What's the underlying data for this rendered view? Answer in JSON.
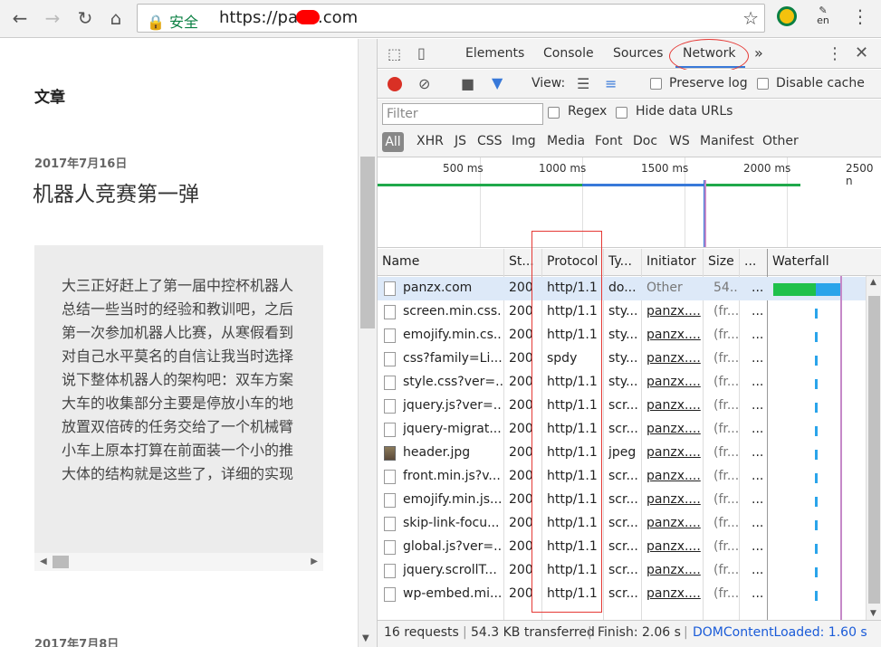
{
  "browser": {
    "secure_label": "安全",
    "url_prefix": "https://pa",
    "url_suffix": ".com",
    "ext_label": "en"
  },
  "page": {
    "section_title": "文章",
    "post_date": "2017年7月16日",
    "post_title": "机器人竞赛第一弹",
    "excerpt": [
      "大三正好赶上了第一届中控杯机器人",
      "总结一些当时的经验和教训吧，之后",
      "第一次参加机器人比赛，从寒假看到",
      "对自己水平莫名的自信让我当时选择",
      "说下整体机器人的架构吧：双车方案",
      "大车的收集部分主要是停放小车的地",
      "放置双倍砖的任务交给了一个机械臂",
      "小车上原本打算在前面装一个小的推",
      "大体的结构就是这些了，详细的实现"
    ],
    "next_post_date": "2017年7月8日"
  },
  "devtools": {
    "tabs": [
      "Elements",
      "Console",
      "Sources",
      "Network"
    ],
    "active_tab": "Network",
    "more_tabs": "»",
    "view_label": "View:",
    "preserve_log": "Preserve log",
    "disable_cache": "Disable cache",
    "filter_placeholder": "Filter",
    "regex": "Regex",
    "hide_data_urls": "Hide data URLs",
    "types": [
      "All",
      "XHR",
      "JS",
      "CSS",
      "Img",
      "Media",
      "Font",
      "Doc",
      "WS",
      "Manifest",
      "Other"
    ],
    "ticks": [
      "500 ms",
      "1000 ms",
      "1500 ms",
      "2000 ms",
      "2500 n"
    ],
    "columns": [
      "Name",
      "St...",
      "Protocol",
      "Ty...",
      "Initiator",
      "Size",
      "...",
      "Waterfall"
    ],
    "rows": [
      {
        "name": "panzx.com",
        "status": "200",
        "protocol": "http/1.1",
        "type": "do...",
        "initiator": "Other",
        "size": "54...",
        "time": "..."
      },
      {
        "name": "screen.min.css...",
        "status": "200",
        "protocol": "http/1.1",
        "type": "sty...",
        "initiator": "panzx....",
        "size": "(fr...",
        "time": "..."
      },
      {
        "name": "emojify.min.cs...",
        "status": "200",
        "protocol": "http/1.1",
        "type": "sty...",
        "initiator": "panzx....",
        "size": "(fr...",
        "time": "..."
      },
      {
        "name": "css?family=Li...",
        "status": "200",
        "protocol": "spdy",
        "type": "sty...",
        "initiator": "panzx....",
        "size": "(fr...",
        "time": "..."
      },
      {
        "name": "style.css?ver=...",
        "status": "200",
        "protocol": "http/1.1",
        "type": "sty...",
        "initiator": "panzx....",
        "size": "(fr...",
        "time": "..."
      },
      {
        "name": "jquery.js?ver=...",
        "status": "200",
        "protocol": "http/1.1",
        "type": "scr...",
        "initiator": "panzx....",
        "size": "(fr...",
        "time": "..."
      },
      {
        "name": "jquery-migrat...",
        "status": "200",
        "protocol": "http/1.1",
        "type": "scr...",
        "initiator": "panzx....",
        "size": "(fr...",
        "time": "..."
      },
      {
        "name": "header.jpg",
        "status": "200",
        "protocol": "http/1.1",
        "type": "jpeg",
        "initiator": "panzx....",
        "size": "(fr...",
        "time": "..."
      },
      {
        "name": "front.min.js?v...",
        "status": "200",
        "protocol": "http/1.1",
        "type": "scr...",
        "initiator": "panzx....",
        "size": "(fr...",
        "time": "..."
      },
      {
        "name": "emojify.min.js...",
        "status": "200",
        "protocol": "http/1.1",
        "type": "scr...",
        "initiator": "panzx....",
        "size": "(fr...",
        "time": "..."
      },
      {
        "name": "skip-link-focu...",
        "status": "200",
        "protocol": "http/1.1",
        "type": "scr...",
        "initiator": "panzx....",
        "size": "(fr...",
        "time": "..."
      },
      {
        "name": "global.js?ver=...",
        "status": "200",
        "protocol": "http/1.1",
        "type": "scr...",
        "initiator": "panzx....",
        "size": "(fr...",
        "time": "..."
      },
      {
        "name": "jquery.scrollT...",
        "status": "200",
        "protocol": "http/1.1",
        "type": "scr...",
        "initiator": "panzx....",
        "size": "(fr...",
        "time": "..."
      },
      {
        "name": "wp-embed.mi...",
        "status": "200",
        "protocol": "http/1.1",
        "type": "scr...",
        "initiator": "panzx....",
        "size": "(fr...",
        "time": "..."
      }
    ],
    "status": {
      "requests": "16 requests",
      "transferred": "54.3 KB transferred",
      "finish": "Finish: 2.06 s",
      "dcl": "DOMContentLoaded: 1.60 s"
    }
  },
  "colors": {
    "accent": "#3879d9",
    "record": "#d93025",
    "annotation": "#e53935"
  }
}
